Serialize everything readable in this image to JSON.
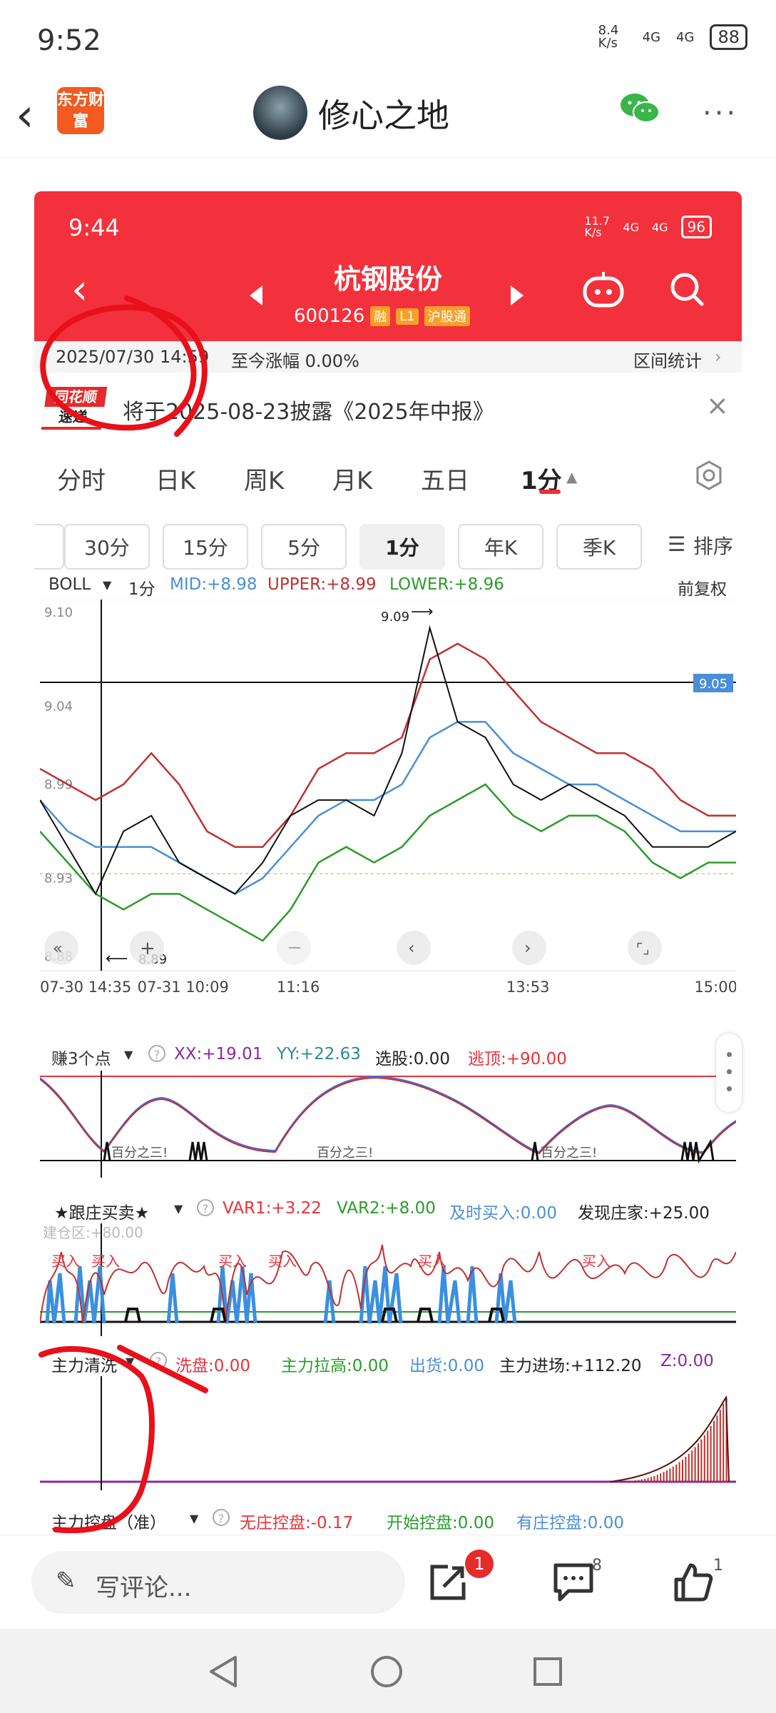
{
  "status": {
    "time": "9:52",
    "net": "8.4 K/s",
    "sig1": "4G",
    "sig2": "4G",
    "battery": "88"
  },
  "header": {
    "logo": "东方财富",
    "title": "修心之地",
    "more": "···"
  },
  "inner_status": {
    "time": "9:44",
    "net": "11.7 K/s",
    "sig1": "4G",
    "sig2": "4G",
    "battery": "96"
  },
  "stock": {
    "name": "杭钢股份",
    "code": "600126",
    "tags": [
      "融",
      "L1",
      "沪股通"
    ]
  },
  "datebar": {
    "date": "2025/07/30 14:59",
    "change": "至今涨幅 0.00%",
    "interval": "区间统计"
  },
  "notice": {
    "logo_top": "同花顺",
    "logo_bottom": "速递",
    "text": "将于2025-08-23披露《2025年中报》",
    "close": "×"
  },
  "tabs": [
    "分时",
    "日K",
    "周K",
    "月K",
    "五日",
    "1分"
  ],
  "period_buttons": [
    "30分",
    "15分",
    "5分",
    "1分",
    "年K",
    "季K"
  ],
  "sort_label": "排序",
  "boll": {
    "name": "BOLL",
    "period": "1分",
    "mid": "MID:+8.98",
    "upper": "UPPER:+8.99",
    "lower": "LOWER:+8.96",
    "adjust": "前复权"
  },
  "colors": {
    "red": "#e8323c",
    "upper": "#c03030",
    "mid": "#4a8fd6",
    "lower": "#2a9d2a",
    "price": "#111111"
  },
  "chart_data": [
    {
      "type": "line",
      "y_ticks": [
        "9.10",
        "9.04",
        "8.99",
        "8.93",
        "8.88"
      ],
      "ylim": [
        8.88,
        9.1
      ],
      "x_ticks": [
        "07-30 14:35",
        "07-31 10:09",
        "11:16",
        "13:53",
        "15:00"
      ],
      "annotations": {
        "high": "9.09",
        "low": "8.89",
        "current": "9.05"
      },
      "series": [
        {
          "name": "UPPER",
          "values": [
            9.0,
            8.99,
            8.98,
            8.99,
            9.01,
            8.99,
            8.96,
            8.95,
            8.95,
            8.97,
            9.0,
            9.01,
            9.01,
            9.02,
            9.07,
            9.08,
            9.07,
            9.05,
            9.03,
            9.02,
            9.01,
            9.01,
            9.0,
            8.98,
            8.97,
            8.97
          ]
        },
        {
          "name": "MID",
          "values": [
            8.98,
            8.96,
            8.95,
            8.95,
            8.95,
            8.94,
            8.93,
            8.92,
            8.93,
            8.95,
            8.97,
            8.98,
            8.98,
            8.99,
            9.02,
            9.03,
            9.03,
            9.01,
            9.0,
            8.99,
            8.99,
            8.98,
            8.97,
            8.96,
            8.96,
            8.96
          ]
        },
        {
          "name": "LOWER",
          "values": [
            8.96,
            8.94,
            8.92,
            8.91,
            8.92,
            8.92,
            8.91,
            8.9,
            8.89,
            8.91,
            8.94,
            8.95,
            8.94,
            8.95,
            8.97,
            8.98,
            8.99,
            8.97,
            8.96,
            8.97,
            8.97,
            8.96,
            8.94,
            8.93,
            8.94,
            8.94
          ]
        },
        {
          "name": "price",
          "values": [
            8.98,
            8.95,
            8.92,
            8.96,
            8.97,
            8.94,
            8.93,
            8.92,
            8.94,
            8.97,
            8.98,
            8.98,
            8.97,
            9.01,
            9.09,
            9.03,
            9.02,
            8.99,
            8.98,
            8.99,
            8.98,
            8.97,
            8.95,
            8.95,
            8.95,
            8.96
          ]
        }
      ]
    }
  ],
  "indicators": {
    "earn": {
      "name": "赚3个点",
      "xx": "XX:+19.01",
      "yy": "YY:+22.63",
      "xg": "选股:0.00",
      "top": "逃顶:+90.00",
      "mark": "百分之三!"
    },
    "follow": {
      "name": "★跟庄买卖★",
      "var1": "VAR1:+3.22",
      "var2": "VAR2:+8.00",
      "buy": "及时买入:0.00",
      "find": "发现庄家:+25.00",
      "build": "建仓区:+80.00",
      "mark": "买入"
    },
    "wash": {
      "name": "主力清洗",
      "wash": "洗盘:0.00",
      "lift": "主力拉高:0.00",
      "ship": "出货:0.00",
      "enter": "主力进场:+112.20",
      "z": "Z:0.00"
    },
    "control": {
      "name": "主力控盘（准）",
      "none": "无庄控盘:-0.17",
      "start": "开始控盘:0.00",
      "have": "有庄控盘:0.00"
    }
  },
  "bottom": {
    "comment": "写评论...",
    "share_badge": "1",
    "comments_count": "8",
    "likes_count": "1"
  }
}
